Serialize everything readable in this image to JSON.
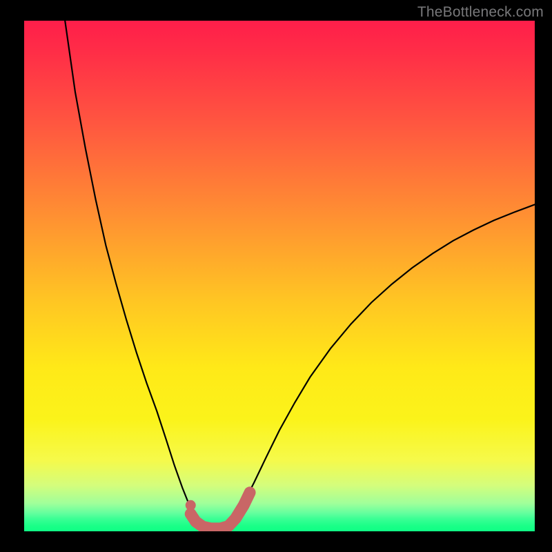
{
  "watermark": "TheBottleneck.com",
  "colors": {
    "background": "#000000",
    "curve_stroke": "#000000",
    "marker_stroke": "#c96666",
    "marker_fill": "#c96666"
  },
  "chart_data": {
    "type": "line",
    "title": "",
    "xlabel": "",
    "ylabel": "",
    "xlim": [
      0,
      100
    ],
    "ylim": [
      0,
      100
    ],
    "grid": false,
    "legend": false,
    "curve_points": [
      {
        "x": 8.0,
        "y": 100.0
      },
      {
        "x": 10.0,
        "y": 86.0
      },
      {
        "x": 12.0,
        "y": 75.0
      },
      {
        "x": 14.0,
        "y": 65.0
      },
      {
        "x": 16.0,
        "y": 56.0
      },
      {
        "x": 18.0,
        "y": 48.5
      },
      {
        "x": 20.0,
        "y": 41.5
      },
      {
        "x": 22.0,
        "y": 35.0
      },
      {
        "x": 24.0,
        "y": 29.0
      },
      {
        "x": 26.0,
        "y": 23.5
      },
      {
        "x": 27.8,
        "y": 18.0
      },
      {
        "x": 29.4,
        "y": 13.0
      },
      {
        "x": 31.0,
        "y": 8.5
      },
      {
        "x": 32.4,
        "y": 5.0
      },
      {
        "x": 33.6,
        "y": 2.8
      },
      {
        "x": 35.0,
        "y": 1.4
      },
      {
        "x": 36.6,
        "y": 0.9
      },
      {
        "x": 38.4,
        "y": 0.9
      },
      {
        "x": 40.0,
        "y": 1.4
      },
      {
        "x": 41.4,
        "y": 3.0
      },
      {
        "x": 43.0,
        "y": 5.6
      },
      {
        "x": 45.0,
        "y": 9.5
      },
      {
        "x": 47.4,
        "y": 14.5
      },
      {
        "x": 50.0,
        "y": 19.8
      },
      {
        "x": 53.0,
        "y": 25.2
      },
      {
        "x": 56.0,
        "y": 30.2
      },
      {
        "x": 60.0,
        "y": 35.8
      },
      {
        "x": 64.0,
        "y": 40.6
      },
      {
        "x": 68.0,
        "y": 44.8
      },
      {
        "x": 72.0,
        "y": 48.4
      },
      {
        "x": 76.0,
        "y": 51.6
      },
      {
        "x": 80.0,
        "y": 54.4
      },
      {
        "x": 84.0,
        "y": 56.9
      },
      {
        "x": 88.0,
        "y": 59.0
      },
      {
        "x": 92.0,
        "y": 60.9
      },
      {
        "x": 96.0,
        "y": 62.5
      },
      {
        "x": 100.0,
        "y": 64.0
      }
    ],
    "marker_dot": {
      "x": 32.6,
      "y": 5.1
    },
    "marker_segment": [
      {
        "x": 32.6,
        "y": 3.4
      },
      {
        "x": 33.6,
        "y": 1.9
      },
      {
        "x": 35.0,
        "y": 0.9
      },
      {
        "x": 36.6,
        "y": 0.55
      },
      {
        "x": 38.4,
        "y": 0.55
      },
      {
        "x": 40.0,
        "y": 1.0
      },
      {
        "x": 41.4,
        "y": 2.5
      },
      {
        "x": 43.0,
        "y": 5.1
      },
      {
        "x": 44.2,
        "y": 7.6
      }
    ]
  }
}
